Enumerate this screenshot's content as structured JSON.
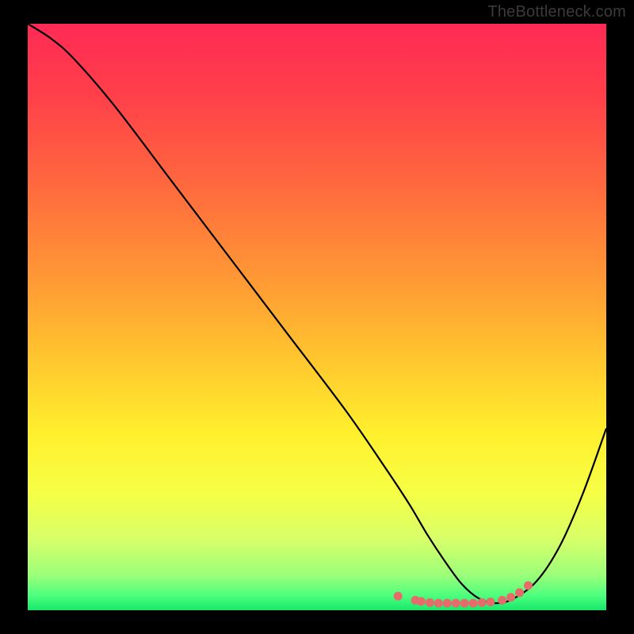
{
  "watermark": "TheBottleneck.com",
  "chart_data": {
    "type": "line",
    "title": "",
    "xlabel": "",
    "ylabel": "",
    "xlim": [
      0,
      100
    ],
    "ylim": [
      0,
      100
    ],
    "series": [
      {
        "name": "curve",
        "x": [
          0,
          4,
          8,
          15,
          25,
          35,
          45,
          55,
          62,
          66,
          69,
          72,
          75,
          78,
          81,
          84,
          88,
          92,
          96,
          100
        ],
        "y": [
          100,
          97.5,
          94,
          86,
          73,
          60,
          47,
          34,
          24,
          18,
          13,
          8.5,
          4.5,
          2,
          1.2,
          2,
          5,
          11,
          20,
          31
        ],
        "color": "#000000"
      },
      {
        "name": "markers",
        "x": [
          64,
          67,
          68,
          69.5,
          71,
          72.5,
          74,
          75.5,
          77,
          78.5,
          80,
          82,
          83.5,
          85,
          86.5
        ],
        "y": [
          2.4,
          1.7,
          1.5,
          1.3,
          1.2,
          1.2,
          1.2,
          1.2,
          1.2,
          1.3,
          1.4,
          1.7,
          2.2,
          3.0,
          4.2
        ],
        "color": "#e76b6b"
      }
    ],
    "background_gradient": {
      "stops": [
        {
          "offset": 0.0,
          "color": "#ff2a55"
        },
        {
          "offset": 0.12,
          "color": "#ff3f4a"
        },
        {
          "offset": 0.28,
          "color": "#ff6a3e"
        },
        {
          "offset": 0.44,
          "color": "#ff9a34"
        },
        {
          "offset": 0.58,
          "color": "#ffc92e"
        },
        {
          "offset": 0.7,
          "color": "#fff02d"
        },
        {
          "offset": 0.8,
          "color": "#f6ff45"
        },
        {
          "offset": 0.88,
          "color": "#d7ff6a"
        },
        {
          "offset": 0.94,
          "color": "#9cff7a"
        },
        {
          "offset": 0.975,
          "color": "#4dff7d"
        },
        {
          "offset": 1.0,
          "color": "#17e86b"
        }
      ]
    }
  }
}
